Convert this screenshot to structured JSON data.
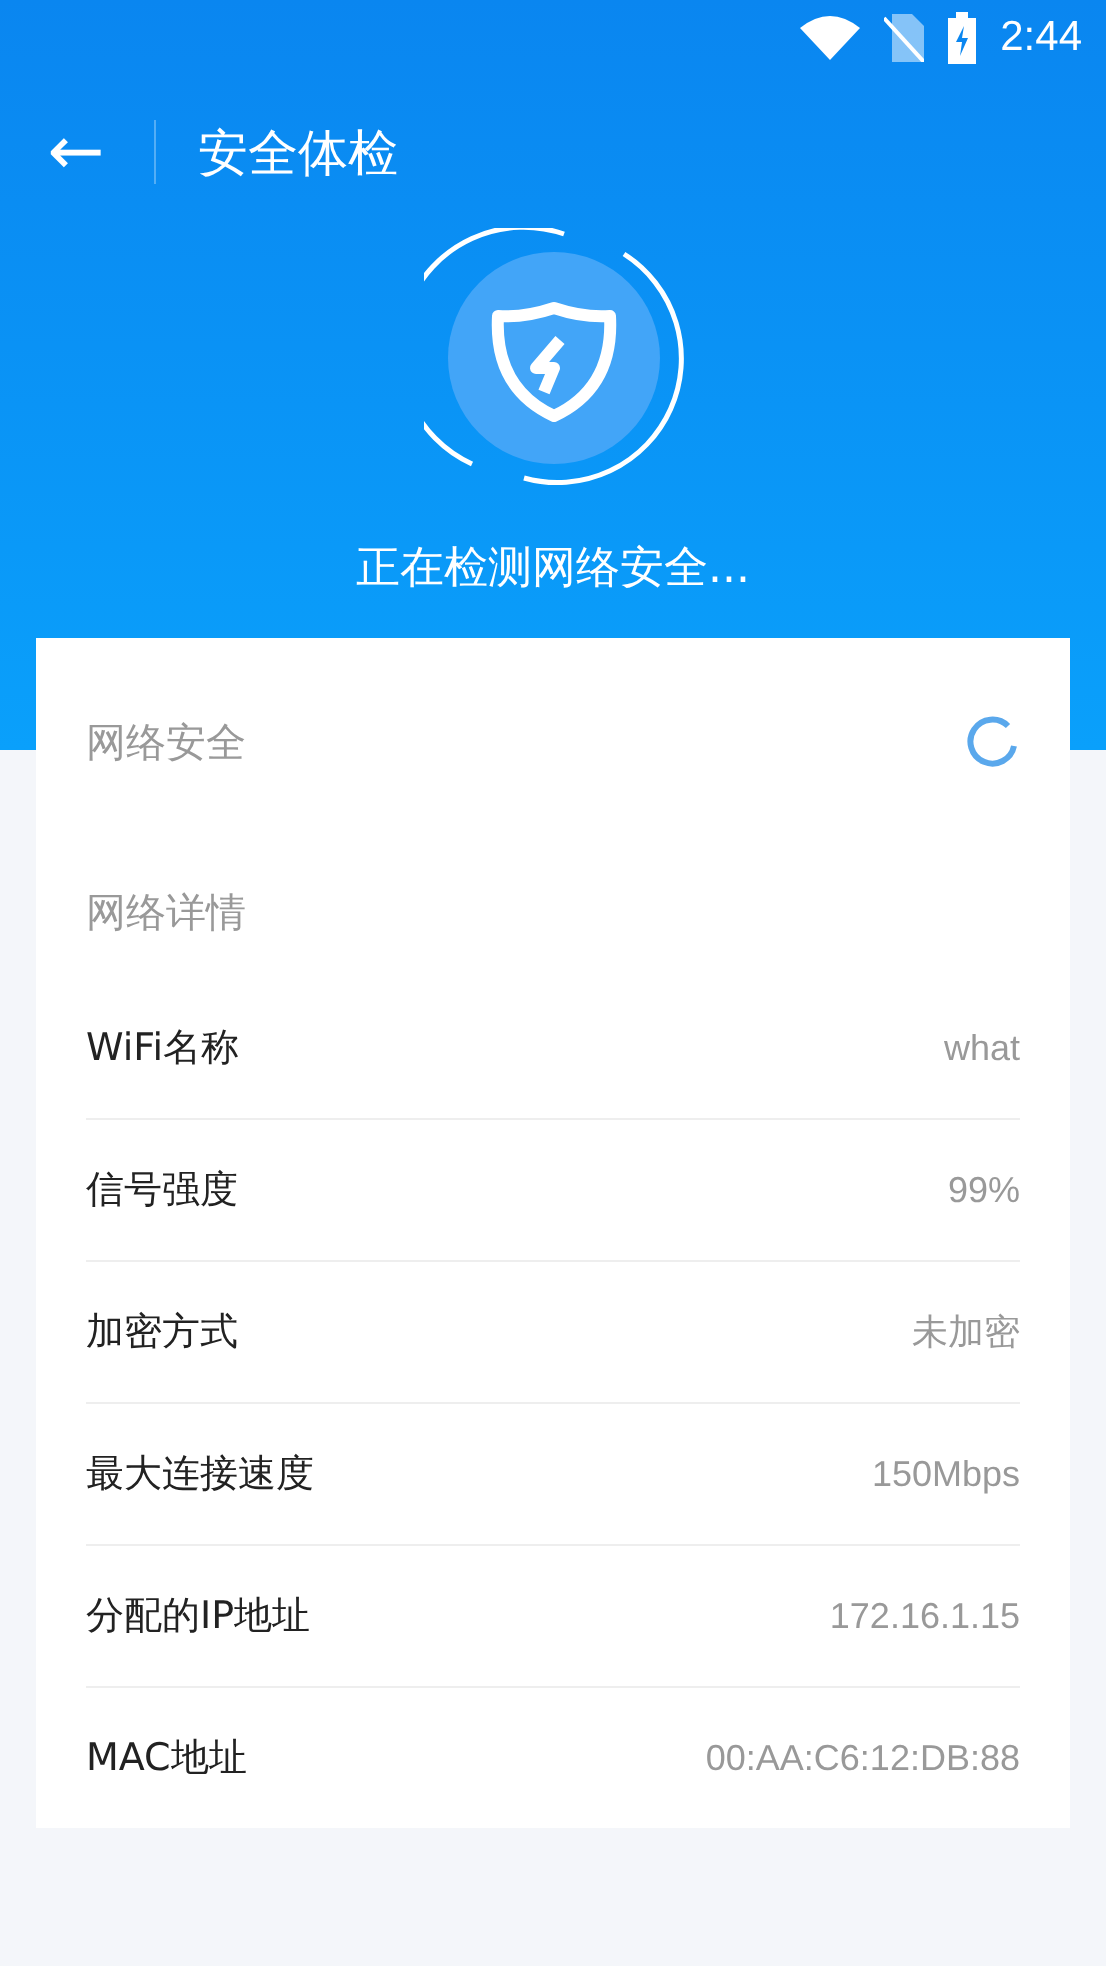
{
  "status_bar": {
    "time": "2:44"
  },
  "header": {
    "back_icon": "←",
    "title": "安全体检"
  },
  "scan": {
    "status": "正在检测网络安全..."
  },
  "security": {
    "label": "网络安全",
    "loading": true
  },
  "details": {
    "title": "网络详情",
    "rows": [
      {
        "label": "WiFi名称",
        "value": "what"
      },
      {
        "label": "信号强度",
        "value": "99%"
      },
      {
        "label": "加密方式",
        "value": "未加密"
      },
      {
        "label": "最大连接速度",
        "value": "150Mbps"
      },
      {
        "label": "分配的IP地址",
        "value": "172.16.1.15"
      },
      {
        "label": "MAC地址",
        "value": "00:AA:C6:12:DB:88"
      }
    ]
  }
}
